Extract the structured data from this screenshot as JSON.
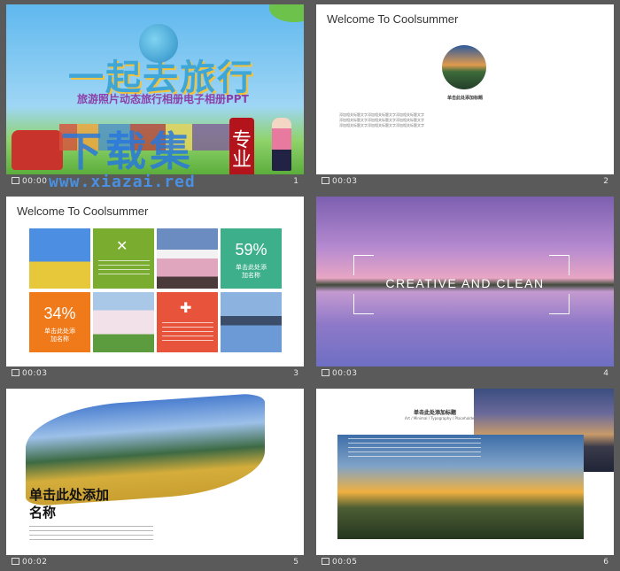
{
  "slides": [
    {
      "time": "00:00",
      "number": "1",
      "title_art": "一起去旅行",
      "subtitle": "旅游照片动态旅行相册电子相册PPT"
    },
    {
      "time": "00:03",
      "number": "2",
      "heading": "Welcome To Coolsummer",
      "caption": "单击此处添加标题",
      "paragraphs": [
        "添加相关标题文字添加相关标题文字添加相关标题文字",
        "添加相关标题文字添加相关标题文字添加相关标题文字",
        "添加相关标题文字添加相关标题文字添加相关标题文字"
      ]
    },
    {
      "time": "00:03",
      "number": "3",
      "heading": "Welcome To Coolsummer",
      "pct1": "59%",
      "label1": "单击此处添加名称",
      "pct2": "34%",
      "label2": "单击此处添加名称"
    },
    {
      "time": "00:03",
      "number": "4",
      "headline": "CREATIVE AND CLEAN"
    },
    {
      "time": "00:02",
      "number": "5",
      "heading": "单击此处添加名称"
    },
    {
      "time": "00:05",
      "number": "6",
      "heading": "单击此处添加标题",
      "subheading": "Art / Minimal / Typography / Placeholder"
    }
  ],
  "watermark": {
    "text": "下载集",
    "stamp": "专业",
    "url": "www.xiazai.red"
  },
  "colors": {
    "green": "#7aad2f",
    "teal": "#3daf8b",
    "orange": "#f07a1a",
    "red": "#e7533b"
  }
}
